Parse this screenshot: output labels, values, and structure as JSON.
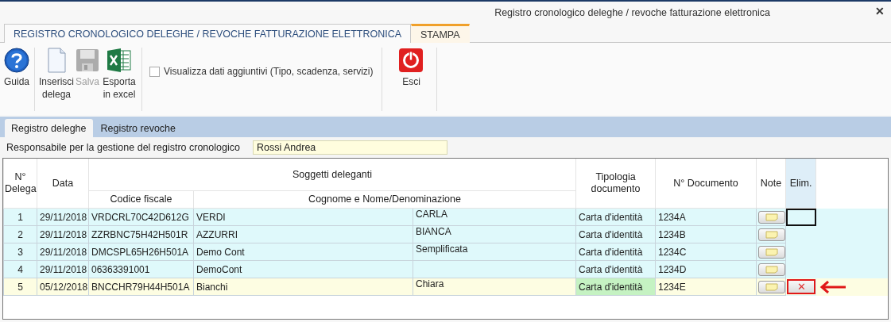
{
  "window": {
    "title": "Registro cronologico deleghe / revoche fatturazione elettronica",
    "close": "✕"
  },
  "ribbon_tabs": [
    {
      "label": "REGISTRO CRONOLOGICO DELEGHE / REVOCHE FATTURAZIONE ELETTRONICA",
      "selected": true
    },
    {
      "label": "STAMPA",
      "selected": false
    }
  ],
  "toolbar": [
    {
      "kind": "help",
      "label": "Guida",
      "disabled": false
    },
    {
      "kind": "new",
      "label": "Inserisci delega",
      "disabled": false
    },
    {
      "kind": "save",
      "label": "Salva",
      "disabled": true
    },
    {
      "kind": "excel",
      "label": "Esporta in excel",
      "disabled": false
    },
    {
      "kind": "checkbox",
      "label": "Visualizza dati aggiuntivi (Tipo, scadenza, servizi)",
      "checked": false
    },
    {
      "kind": "exit",
      "label": "Esci",
      "disabled": false
    }
  ],
  "sub_tabs": [
    {
      "label": "Registro deleghe",
      "selected": true
    },
    {
      "label": "Registro revoche",
      "selected": false
    }
  ],
  "responsabile": {
    "label": "Responsabile per la gestione del registro cronologico",
    "value": "Rossi Andrea"
  },
  "table": {
    "columns": {
      "number": "N° Delega",
      "date": "Data",
      "group": "Soggetti deleganti",
      "tax_code": "Codice fiscale",
      "name": "Cognome e Nome/Denominazione",
      "doc_type": "Tipologia documento",
      "doc_no": "N° Documento",
      "note": "Note",
      "delete": "Elim."
    },
    "rows": [
      {
        "number": "1",
        "date": "29/11/2018",
        "tax_code": "VRDCRL70C42D612G",
        "surname": "VERDI",
        "first_name": "CARLA",
        "doc_type": "Carta d'identità",
        "doc_no": "1234A",
        "selected": false,
        "focused": true
      },
      {
        "number": "2",
        "date": "29/11/2018",
        "tax_code": "ZZRBNC75H42H501R",
        "surname": "AZZURRI",
        "first_name": "BIANCA",
        "doc_type": "Carta d'identità",
        "doc_no": "1234B",
        "selected": false,
        "focused": false
      },
      {
        "number": "3",
        "date": "29/11/2018",
        "tax_code": "DMCSPL65H26H501A",
        "surname": "Demo Cont",
        "first_name": "Semplificata",
        "doc_type": "Carta d'identità",
        "doc_no": "1234C",
        "selected": false,
        "focused": false
      },
      {
        "number": "4",
        "date": "29/11/2018",
        "tax_code": "06363391001",
        "surname": "DemoCont",
        "doc_type": "Carta d'identità",
        "doc_no": "1234D",
        "selected": false,
        "focused": false
      },
      {
        "number": "5",
        "date": "05/12/2018",
        "tax_code": "BNCCHR79H44H501A",
        "surname": "Bianchi",
        "first_name": "Chiara",
        "doc_type": "Carta d'identità",
        "doc_no": "1234E",
        "selected": true,
        "focused": false,
        "delete_mark": "✕"
      }
    ]
  }
}
